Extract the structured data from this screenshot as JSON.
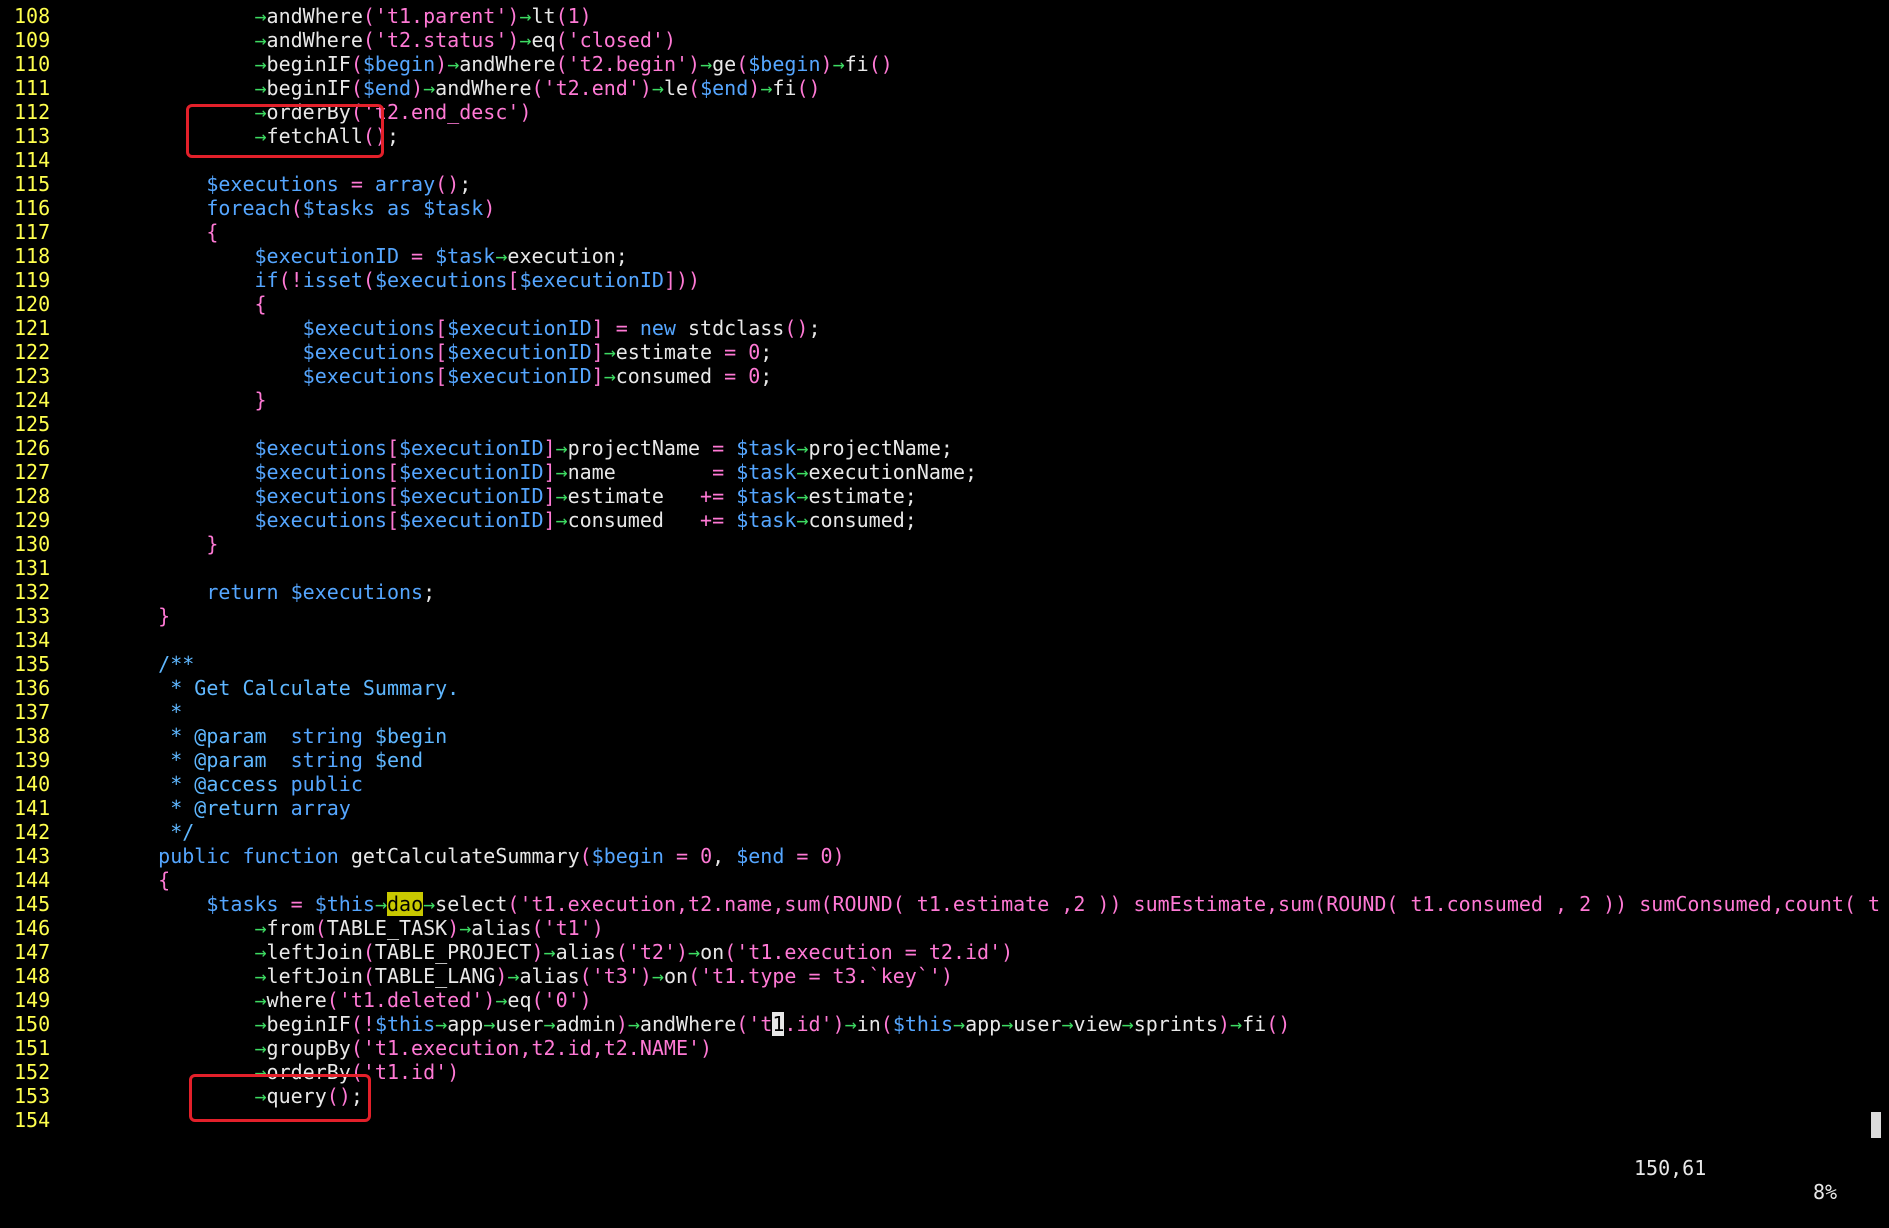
{
  "lines": [
    {
      "n": "108",
      "t": "            →andWhere('t1.parent')→lt(1)"
    },
    {
      "n": "109",
      "t": "            →andWhere('t2.status')→eq('closed')"
    },
    {
      "n": "110",
      "t": "            →beginIF($begin)→andWhere('t2.begin')→ge($begin)→fi()"
    },
    {
      "n": "111",
      "t": "            →beginIF($end)→andWhere('t2.end')→le($end)→fi()"
    },
    {
      "n": "112",
      "t": "            →orderBy('t2.end_desc')"
    },
    {
      "n": "113",
      "t": "            →fetchAll();"
    },
    {
      "n": "114",
      "t": ""
    },
    {
      "n": "115",
      "t": "        $executions = array();"
    },
    {
      "n": "116",
      "t": "        foreach($tasks as $task)"
    },
    {
      "n": "117",
      "t": "        {"
    },
    {
      "n": "118",
      "t": "            $executionID = $task→execution;"
    },
    {
      "n": "119",
      "t": "            if(!isset($executions[$executionID]))"
    },
    {
      "n": "120",
      "t": "            {"
    },
    {
      "n": "121",
      "t": "                $executions[$executionID] = new stdclass();"
    },
    {
      "n": "122",
      "t": "                $executions[$executionID]→estimate = 0;"
    },
    {
      "n": "123",
      "t": "                $executions[$executionID]→consumed = 0;"
    },
    {
      "n": "124",
      "t": "            }"
    },
    {
      "n": "125",
      "t": ""
    },
    {
      "n": "126",
      "t": "            $executions[$executionID]→projectName = $task→projectName;"
    },
    {
      "n": "127",
      "t": "            $executions[$executionID]→name        = $task→executionName;"
    },
    {
      "n": "128",
      "t": "            $executions[$executionID]→estimate   += $task→estimate;"
    },
    {
      "n": "129",
      "t": "            $executions[$executionID]→consumed   += $task→consumed;"
    },
    {
      "n": "130",
      "t": "        }"
    },
    {
      "n": "131",
      "t": ""
    },
    {
      "n": "132",
      "t": "        return $executions;"
    },
    {
      "n": "133",
      "t": "    }"
    },
    {
      "n": "134",
      "t": ""
    },
    {
      "n": "135",
      "t": "    /**"
    },
    {
      "n": "136",
      "t": "     * Get Calculate Summary."
    },
    {
      "n": "137",
      "t": "     *"
    },
    {
      "n": "138",
      "t": "     * @param  string $begin"
    },
    {
      "n": "139",
      "t": "     * @param  string $end"
    },
    {
      "n": "140",
      "t": "     * @access public"
    },
    {
      "n": "141",
      "t": "     * @return array"
    },
    {
      "n": "142",
      "t": "     */"
    },
    {
      "n": "143",
      "t": "    public function getCalculateSummary($begin = 0, $end = 0)"
    },
    {
      "n": "144",
      "t": "    {"
    },
    {
      "n": "145",
      "t": "        $tasks = $this→dao→select('t1.execution,t2.name,sum(ROUND( t1.estimate ,2 )) sumEstimate,sum(ROUND( t1.consumed , 2 )) sumConsumed,count( t"
    },
    {
      "n": "146",
      "t": "            →from(TABLE_TASK)→alias('t1')"
    },
    {
      "n": "147",
      "t": "            →leftJoin(TABLE_PROJECT)→alias('t2')→on('t1.execution = t2.id')"
    },
    {
      "n": "148",
      "t": "            →leftJoin(TABLE_LANG)→alias('t3')→on('t1.type = t3.`key`')"
    },
    {
      "n": "149",
      "t": "            →where('t1.deleted')→eq('0')"
    },
    {
      "n": "150",
      "t": "            →beginIF(!$this→app→user→admin)→andWhere('t1.id')→in($this→app→user→view→sprints)→fi()"
    },
    {
      "n": "151",
      "t": "            →groupBy('t1.execution,t2.id,t2.NAME')"
    },
    {
      "n": "152",
      "t": "            →orderBy('t1.id')"
    },
    {
      "n": "153",
      "t": "            →query();"
    },
    {
      "n": "154",
      "t": ""
    }
  ],
  "status": {
    "position": "150,61",
    "percent": "8%"
  },
  "colors": {
    "line_number": "#ffff4d",
    "string": "#ff79d5",
    "keyword": "#55a6ff",
    "arrow": "#3ddb62",
    "highlight_box": "#e3202a"
  }
}
